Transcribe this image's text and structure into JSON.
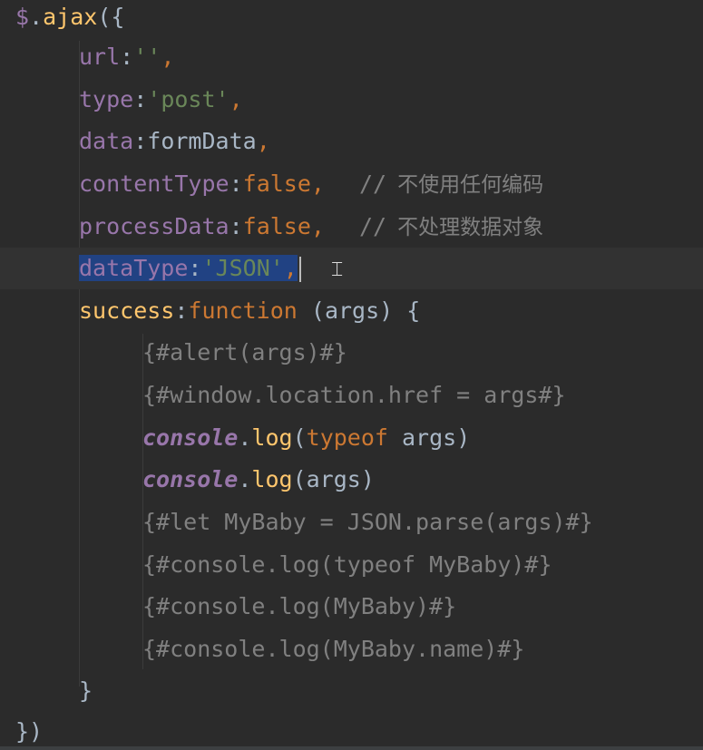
{
  "code": {
    "l1": {
      "a": "$",
      "b": ".",
      "c": "ajax",
      "d": "({"
    },
    "l2": {
      "a": "url",
      "b": ":",
      "c": "''",
      "d": ","
    },
    "l3": {
      "a": "type",
      "b": ":",
      "c": "'post'",
      "d": ","
    },
    "l4": {
      "a": "data",
      "b": ":",
      "c": "formData",
      "d": ","
    },
    "l5": {
      "a": "contentType",
      "b": ":",
      "c": "false",
      "d": ",",
      "e": "//",
      "f": "不使用任何编码"
    },
    "l6": {
      "a": "processData",
      "b": ":",
      "c": "false",
      "d": ",",
      "e": "//",
      "f": "不处理数据对象"
    },
    "l7": {
      "a": "dataType",
      "b": ":",
      "c": "'JSON'",
      "d": ","
    },
    "l8": {
      "a": "success",
      "b": ":",
      "c": "function",
      "d": " (args) {"
    },
    "l9": {
      "a": "{#alert(args)#}"
    },
    "l10": {
      "a": "{#window.location.href = args#}"
    },
    "l11": {
      "a": "console",
      "b": ".",
      "c": "log",
      "d": "(",
      "e": "typeof",
      "f": " args)"
    },
    "l12": {
      "a": "console",
      "b": ".",
      "c": "log",
      "d": "(args)"
    },
    "l13": {
      "a": "{#let MyBaby = JSON.parse(args)#}"
    },
    "l14": {
      "a": "{#console.log(typeof MyBaby)#}"
    },
    "l15": {
      "a": "{#console.log(MyBaby)#}"
    },
    "l16": {
      "a": "{#console.log(MyBaby.name)#}"
    },
    "l17": {
      "a": "}"
    },
    "l18": {
      "a": "})"
    }
  },
  "colors": {
    "background": "#2b2b2b",
    "selection": "#214283",
    "property": "#9876aa",
    "string": "#6a8759",
    "keyword": "#cc7832",
    "function": "#ffc66d",
    "comment": "#808080"
  },
  "icons": {
    "cursor": "text-cursor-icon"
  }
}
